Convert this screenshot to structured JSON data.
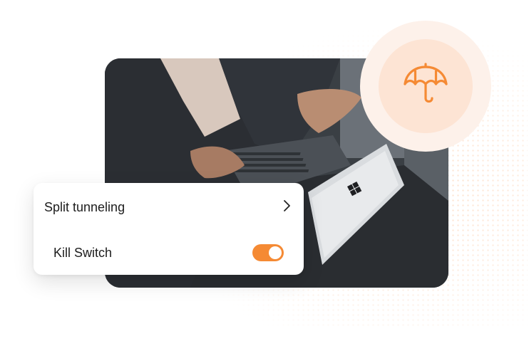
{
  "settings": {
    "split_tunneling_label": "Split tunneling",
    "kill_switch_label": "Kill Switch",
    "kill_switch_enabled": true
  },
  "colors": {
    "accent": "#f58a34",
    "badge_outer": "#fdf1ea",
    "badge_inner": "#fde4d4"
  },
  "icons": {
    "badge": "umbrella-icon",
    "split_tunneling_chevron": "chevron-right-icon"
  },
  "photo": {
    "description_alt": "Person in a suit working on a laptop"
  }
}
